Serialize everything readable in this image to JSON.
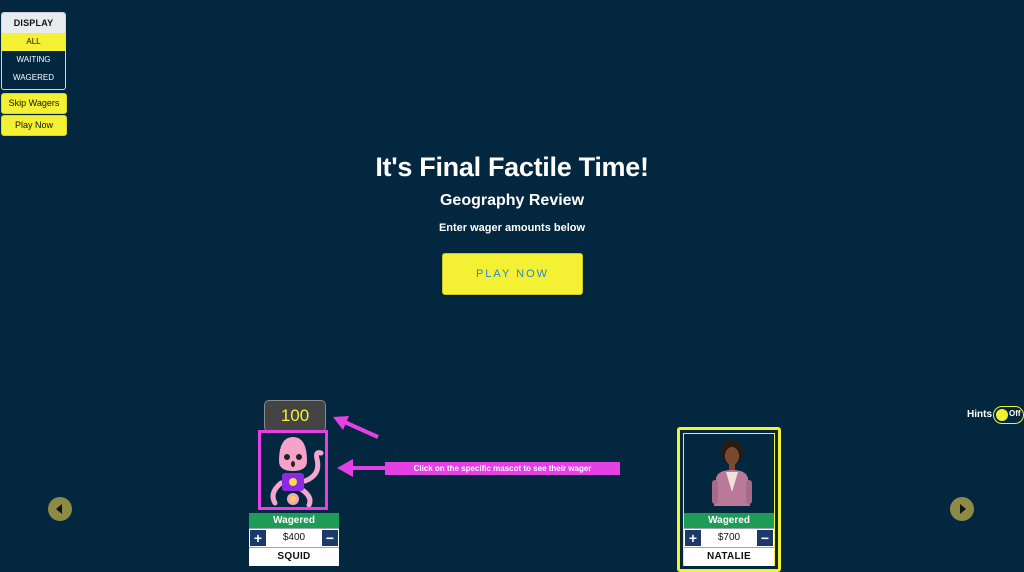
{
  "display_panel": {
    "heading": "DISPLAY",
    "options": [
      "ALL",
      "WAITING",
      "WAGERED"
    ],
    "active_option": "ALL"
  },
  "buttons": {
    "skip_wagers": "Skip Wagers",
    "play_now_small": "Play Now",
    "play_now_main": "PLAY NOW"
  },
  "hero": {
    "title": "It's Final Factile Time!",
    "subtitle": "Geography Review",
    "instruction": "Enter wager amounts below"
  },
  "hints": {
    "label": "Hints",
    "state": "Off"
  },
  "score_badge": "100",
  "annotation": "Click on the specific mascot to see their wager",
  "players": [
    {
      "name": "SQUID",
      "status": "Wagered",
      "amount": "$400",
      "plus": "+",
      "minus": "−"
    },
    {
      "name": "NATALIE",
      "status": "Wagered",
      "amount": "$700",
      "plus": "+",
      "minus": "−"
    }
  ],
  "icons": {
    "nav_left": "chevron-left-icon",
    "nav_right": "chevron-right-icon",
    "mascot_1": "squid-mascot",
    "mascot_2": "person-mascot"
  },
  "colors": {
    "background": "#03273f",
    "accent_yellow": "#f4f135",
    "annotation_magenta": "#e53fe6",
    "wagered_green": "#1e9b57",
    "stepper_navy": "#1b3a6a"
  }
}
